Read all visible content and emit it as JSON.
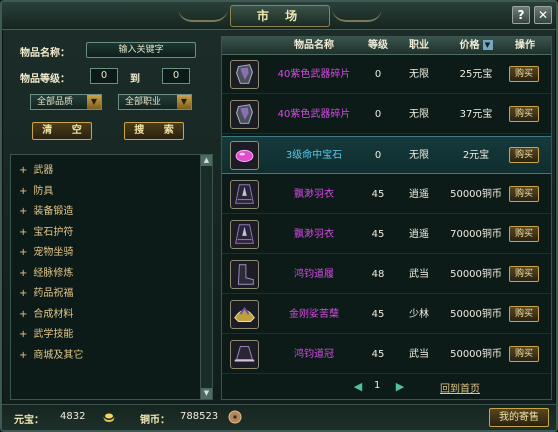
{
  "window": {
    "title": "市 场",
    "help_label": "?",
    "close_label": "✕"
  },
  "search": {
    "name_label": "物品名称：",
    "name_placeholder": "输入关键字",
    "level_label": "物品等级：",
    "level_min": "0",
    "level_to": "到",
    "level_max": "0",
    "quality_select": "全部品质",
    "job_select": "全部职业",
    "clear_button": "清 空",
    "search_button": "搜 索"
  },
  "categories": [
    {
      "label": "武器"
    },
    {
      "label": "防具"
    },
    {
      "label": "装备锻造"
    },
    {
      "label": "宝石护符"
    },
    {
      "label": "宠物坐骑"
    },
    {
      "label": "经脉修炼"
    },
    {
      "label": "药品祝福"
    },
    {
      "label": "合成材料"
    },
    {
      "label": "武学技能"
    },
    {
      "label": "商城及其它"
    }
  ],
  "table": {
    "headers": {
      "name": "物品名称",
      "level": "等级",
      "job": "职业",
      "price": "价格",
      "action": "操作"
    },
    "buy_label": "购买",
    "rows": [
      {
        "icon": "armor-piece-icon",
        "name": "40紫色武器碎片",
        "level": "0",
        "job": "无限",
        "price": "25元宝",
        "color": "purple"
      },
      {
        "icon": "armor-piece-icon",
        "name": "40紫色武器碎片",
        "level": "0",
        "job": "无限",
        "price": "37元宝",
        "color": "purple"
      },
      {
        "icon": "gem-icon",
        "name": "3级命中宝石",
        "level": "0",
        "job": "无限",
        "price": "2元宝",
        "color": "blue"
      },
      {
        "icon": "robe-icon",
        "name": "飘渺羽衣",
        "level": "45",
        "job": "逍遥",
        "price": "50000铜币",
        "color": "purple"
      },
      {
        "icon": "robe-icon",
        "name": "飘渺羽衣",
        "level": "45",
        "job": "逍遥",
        "price": "70000铜币",
        "color": "purple"
      },
      {
        "icon": "boots-icon",
        "name": "鸿钧道履",
        "level": "48",
        "job": "武当",
        "price": "50000铜币",
        "color": "purple"
      },
      {
        "icon": "helmet-icon",
        "name": "金刚娑苦蘖",
        "level": "45",
        "job": "少林",
        "price": "50000铜币",
        "color": "purple"
      },
      {
        "icon": "hat-icon",
        "name": "鸿钧道冠",
        "level": "45",
        "job": "武当",
        "price": "50000铜币",
        "color": "purple"
      }
    ]
  },
  "pager": {
    "page": "1",
    "home_link": "回到首页"
  },
  "footer": {
    "yuanbao_label": "元宝：",
    "yuanbao_value": "4832",
    "copper_label": "铜币：",
    "copper_value": "788523",
    "my_stall_button": "我的寄售"
  }
}
